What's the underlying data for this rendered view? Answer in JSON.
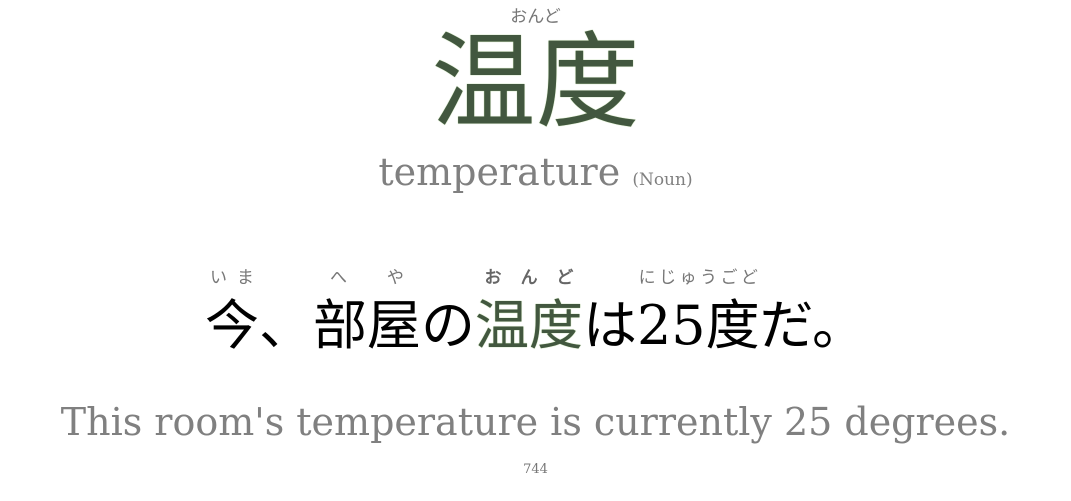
{
  "card": {
    "word": "温度",
    "reading": "おんど",
    "meaning": "temperature",
    "part_of_speech": "(Noun)",
    "sentence": [
      {
        "text": "今",
        "ruby": "いま"
      },
      {
        "text": "、"
      },
      {
        "text": "部屋",
        "ruby": "へや"
      },
      {
        "text": "の"
      },
      {
        "text": "温度",
        "ruby": "おんど",
        "highlight": true
      },
      {
        "text": "は"
      },
      {
        "text": "25度",
        "ruby": "にじゅうごど"
      },
      {
        "text": "だ。"
      }
    ],
    "translation": "This room's temperature is currently 25 degrees.",
    "card_number": "744"
  },
  "colors": {
    "highlight": "#42573f",
    "muted": "#808080"
  }
}
